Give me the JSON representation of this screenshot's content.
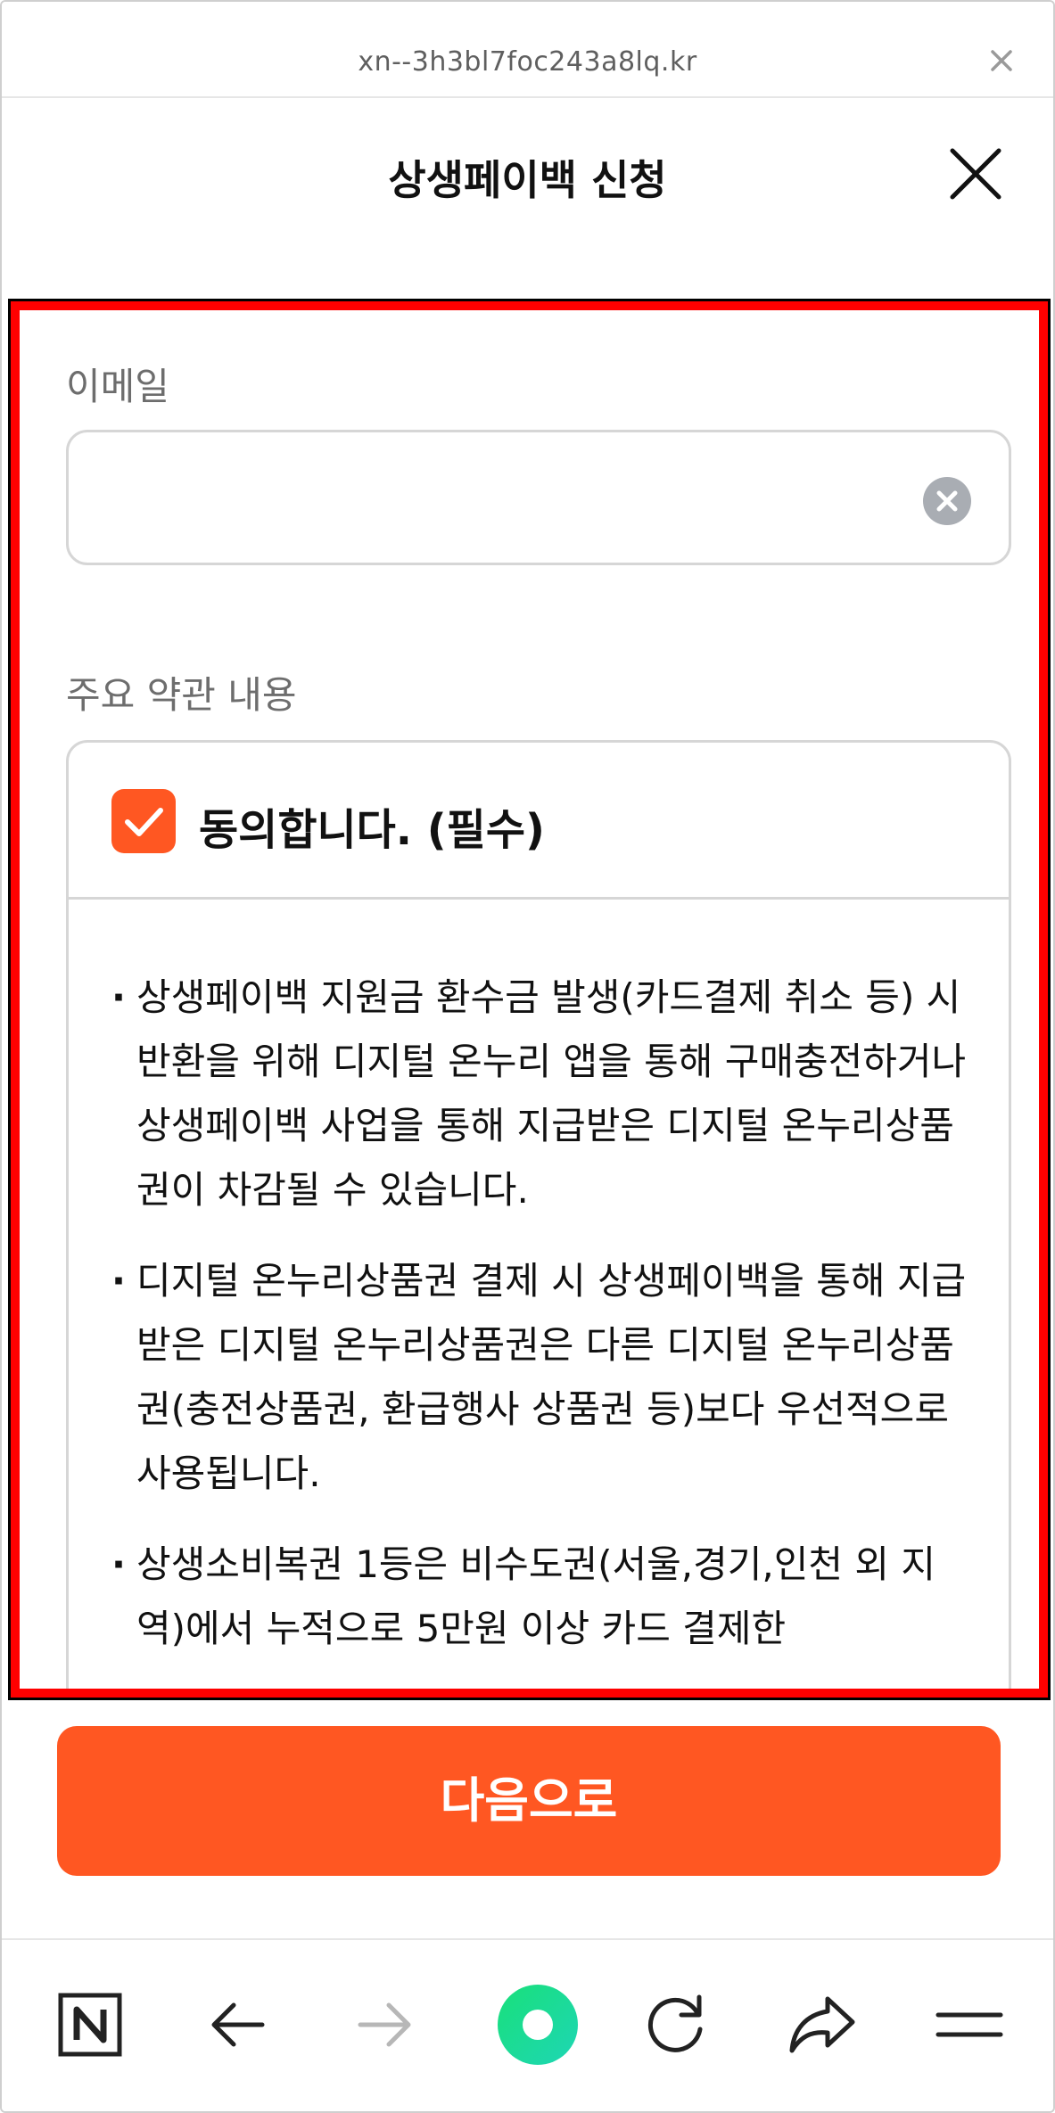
{
  "browser": {
    "url": "xn--3h3bl7foc243a8lq.kr"
  },
  "header": {
    "title": "상생페이백 신청"
  },
  "form": {
    "email_label": "이메일",
    "email_value": "",
    "terms_label": "주요 약관 내용",
    "agree_label": "동의합니다. (필수)",
    "agree_checked": true,
    "terms": [
      "상생페이백 지원금 환수금 발생(카드결제 취소 등) 시 반환을 위해 디지털 온누리 앱을 통해 구매충전하거나 상생페이백 사업을 통해 지급받은 디지털 온누리상품권이 차감될 수 있습니다.",
      "디지털 온누리상품권 결제 시 상생페이백을 통해 지급받은 디지털 온누리상품권은 다른 디지털 온누리상품권(충전상품권, 환급행사 상품권 등)보다 우선적으로 사용됩니다.",
      "상생소비복권 1등은 비수도권(서울,경기,인천 외 지역)에서 누적으로 5만원 이상 카드 결제한"
    ]
  },
  "actions": {
    "next_label": "다음으로"
  },
  "colors": {
    "accent": "#ff5722",
    "highlight": "#ff0000",
    "clear_icon": "#a9adb3",
    "record_icon": "#19e07a"
  },
  "toolbar": {
    "items": [
      "naver-icon",
      "back-arrow-icon",
      "forward-arrow-icon",
      "record-icon",
      "refresh-icon",
      "share-icon",
      "menu-icon"
    ]
  }
}
